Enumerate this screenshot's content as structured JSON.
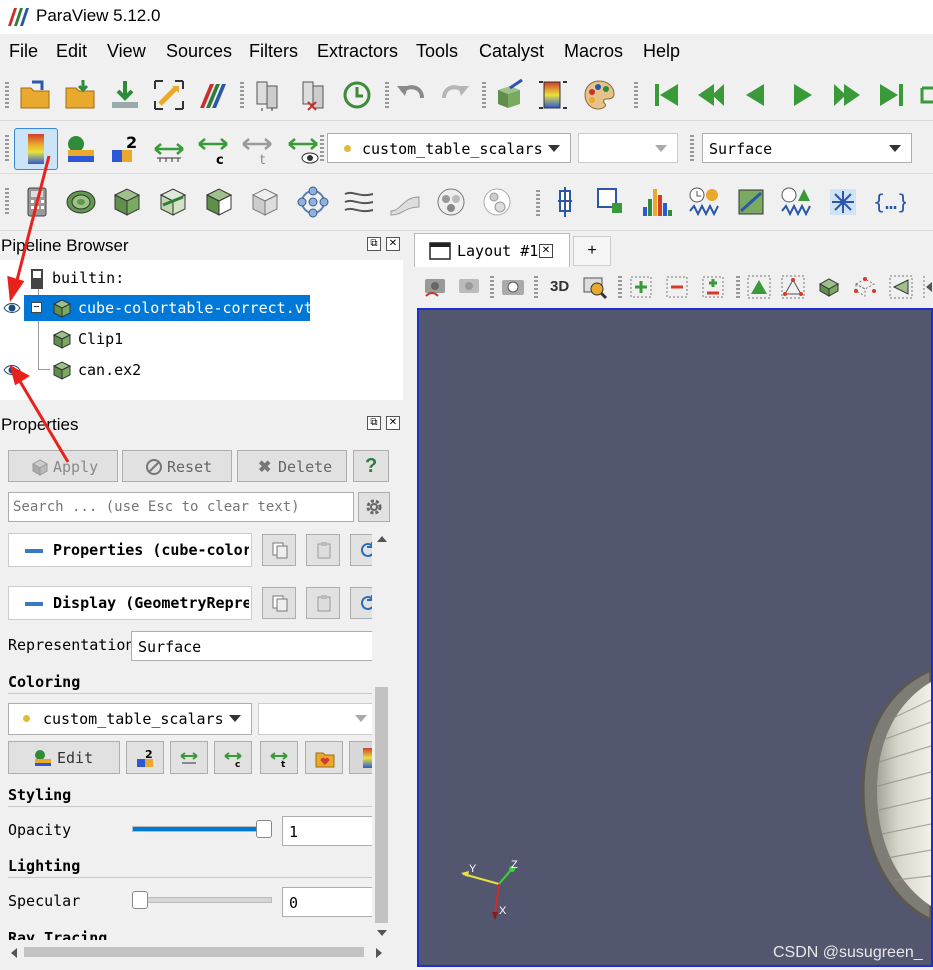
{
  "window": {
    "title": "ParaView 5.12.0"
  },
  "menu": [
    "File",
    "Edit",
    "View",
    "Sources",
    "Filters",
    "Extractors",
    "Tools",
    "Catalyst",
    "Macros",
    "Help"
  ],
  "toolbar2": {
    "color_array": "custom_table_scalars",
    "component": "",
    "representation": "Surface"
  },
  "pipeline_browser": {
    "title": "Pipeline Browser",
    "items": [
      {
        "label": "builtin:",
        "selected": false,
        "visible": null
      },
      {
        "label": "cube-colortable-correct.vtk",
        "selected": true,
        "visible": true
      },
      {
        "label": "Clip1",
        "selected": false,
        "visible": false
      },
      {
        "label": "can.ex2",
        "selected": false,
        "visible": true
      }
    ]
  },
  "properties": {
    "title": "Properties",
    "apply_label": "Apply",
    "reset_label": "Reset",
    "delete_label": "Delete",
    "help_label": "?",
    "search_placeholder": "Search ... (use Esc to clear text)",
    "section_properties": "Properties (cube-colortable-correct.vtk)",
    "section_display": "Display (GeometryRepresentation)",
    "representation_label": "Representation",
    "representation_value": "Surface",
    "coloring_label": "Coloring",
    "coloring_array": "custom_table_scalars",
    "edit_label": "Edit",
    "styling_label": "Styling",
    "opacity_label": "Opacity",
    "opacity_value": "1",
    "opacity_level": 1.0,
    "lighting_label": "Lighting",
    "specular_label": "Specular",
    "specular_value": "0",
    "specular_level": 0.0,
    "raytracing_label": "Ray Tracing"
  },
  "layout": {
    "tab_label": "Layout #1",
    "add_tab_label": "+",
    "three_d_label": "3D"
  },
  "render_view": {
    "axes": {
      "x": "X",
      "y": "Y",
      "z": "Z"
    },
    "watermark": "CSDN @susugreen_",
    "background_color": "#52566e",
    "border_color": "#1c2ed0"
  }
}
